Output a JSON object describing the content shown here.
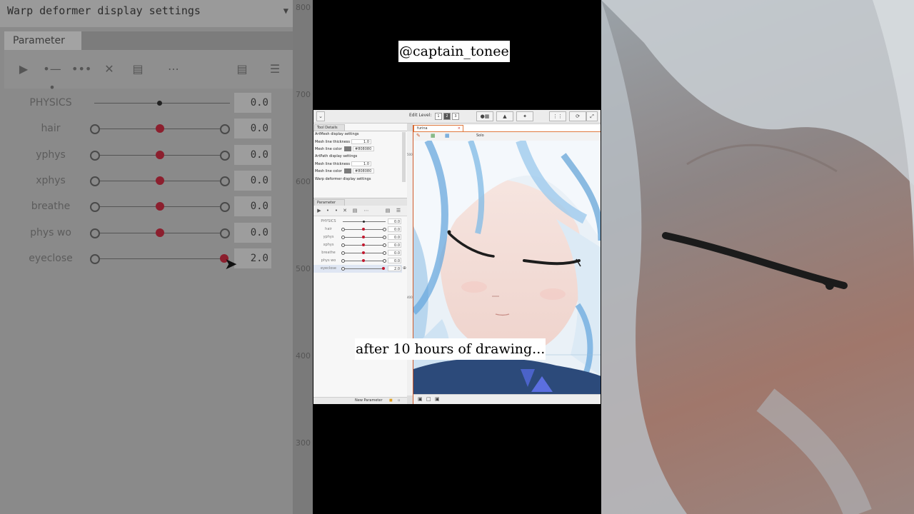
{
  "watermark": "@captain_tonee",
  "caption": "after 10 hours of drawing...",
  "backdrop": {
    "title": "Warp deformer display settings",
    "tab": "Parameter",
    "ruler_marks": [
      "800",
      "700",
      "600",
      "500",
      "400",
      "300"
    ],
    "params": [
      {
        "name": "PHYSICS",
        "value": "0.0"
      },
      {
        "name": "hair",
        "value": "0.0"
      },
      {
        "name": "yphys",
        "value": "0.0"
      },
      {
        "name": "xphys",
        "value": "0.0"
      },
      {
        "name": "breathe",
        "value": "0.0"
      },
      {
        "name": "phys wo",
        "value": "0.0"
      },
      {
        "name": "eyeclose",
        "value": "2.0"
      }
    ]
  },
  "editor": {
    "edit_level_label": "Edit Level:",
    "edit_levels": [
      "1",
      "2",
      "3"
    ],
    "tool_details_tab": "Tool Details",
    "artmesh_title": "ArtMesh display settings",
    "mesh_line_thickness_label": "Mesh line thickness",
    "mesh_line_thickness_value": "1.0",
    "mesh_line_color_label": "Mesh line color",
    "mesh_line_color_value": "#808080",
    "artpath_title": "ArtPath display settings",
    "artpath_thickness_label": "Mesh line thickness",
    "artpath_thickness_value": "1.0",
    "artpath_color_label": "Mesh line color",
    "artpath_color_value": "#808080",
    "warp_title": "Warp deformer display settings",
    "parameter_tab": "Parameter",
    "params": [
      {
        "name": "PHYSICS",
        "value": "0.0"
      },
      {
        "name": "hair",
        "value": "0.0"
      },
      {
        "name": "yphys",
        "value": "0.0"
      },
      {
        "name": "xphys",
        "value": "0.0"
      },
      {
        "name": "breathe",
        "value": "0.0"
      },
      {
        "name": "phys wo",
        "value": "0.0"
      },
      {
        "name": "eyeclose",
        "value": "2.0"
      }
    ],
    "new_parameter": "New Parameter",
    "canvas_tab": "furina",
    "solo_label": "Solo",
    "ruler_marks": [
      "500",
      "400"
    ]
  },
  "colors": {
    "accent": "#e07a3e",
    "knob": "#c2182e"
  }
}
